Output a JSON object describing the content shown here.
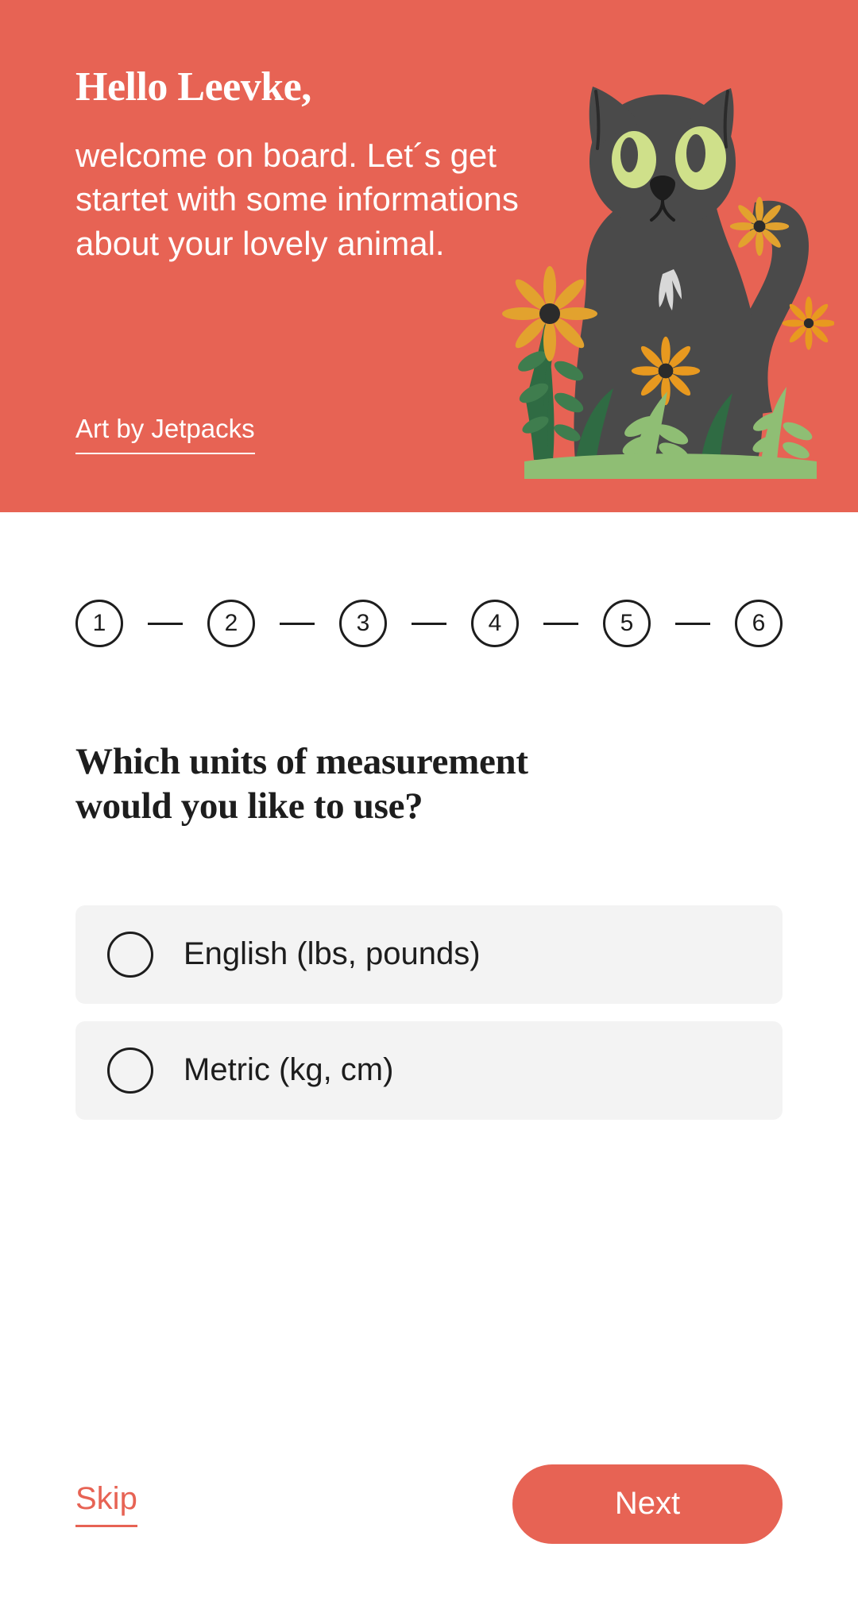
{
  "theme": {
    "accent": "#e76354",
    "ink": "#1d1d1d",
    "card_bg": "#f3f3f3",
    "page_bg": "#ffffff"
  },
  "hero": {
    "greeting": "Hello Leevke,",
    "intro": "welcome on board. Let´s get startet with some informations about your lovely animal.",
    "credit_label": "Art by Jetpacks",
    "illustration_name": "black-cat-with-flowers-illustration"
  },
  "stepper": {
    "steps": [
      {
        "label": "1"
      },
      {
        "label": "2"
      },
      {
        "label": "3"
      },
      {
        "label": "4"
      },
      {
        "label": "5"
      },
      {
        "label": "6"
      }
    ]
  },
  "main": {
    "question": "Which units of measurement would you like to use?",
    "options": [
      {
        "label": "English (lbs, pounds)",
        "selected": false
      },
      {
        "label": "Metric (kg, cm)",
        "selected": false
      }
    ]
  },
  "footer": {
    "skip_label": "Skip",
    "next_label": "Next"
  }
}
